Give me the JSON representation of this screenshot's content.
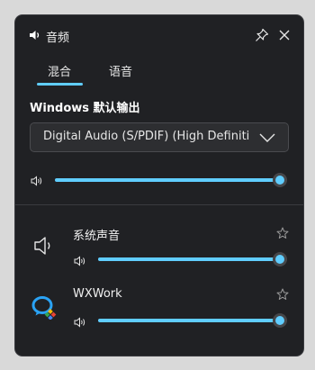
{
  "window": {
    "title": "音频"
  },
  "tabs": [
    {
      "label": "混合"
    },
    {
      "label": "语音"
    }
  ],
  "device": {
    "heading": "Windows 默认输出",
    "selected": "Digital Audio (S/PDIF) (High Definition Audio Device)",
    "volume_fraction": 1.0
  },
  "apps": [
    {
      "name": "系统声音",
      "icon": "speaker-icon",
      "volume_fraction": 1.0
    },
    {
      "name": "WXWork",
      "icon": "wxwork-icon",
      "volume_fraction": 1.0
    }
  ],
  "colors": {
    "accent": "#60cdff",
    "panel": "#202124"
  }
}
